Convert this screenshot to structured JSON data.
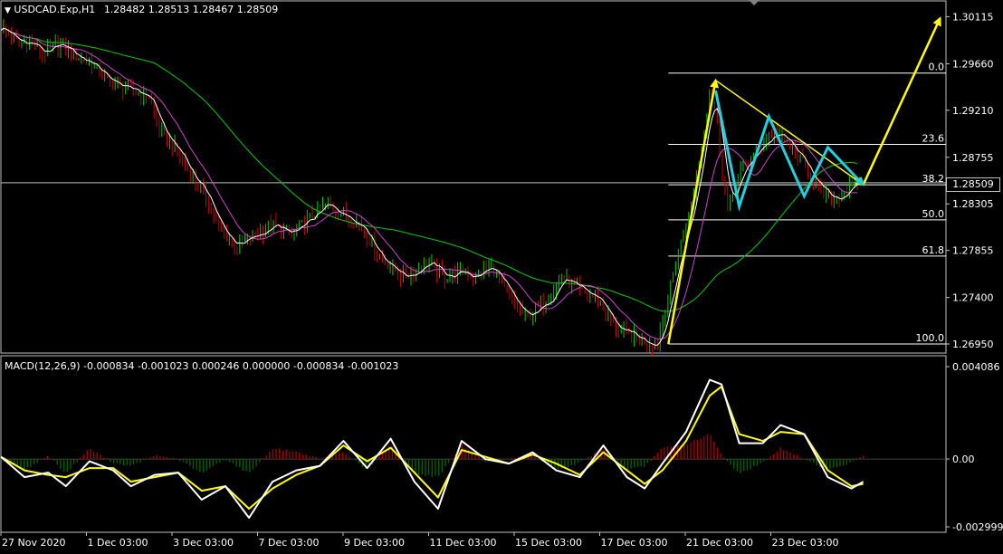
{
  "header": {
    "symbol": "USDCAD.Exp,H1",
    "ohlc": "1.28482 1.28513 1.28467 1.28509"
  },
  "macd": {
    "label": "MACD(12,26,9) -0.000834 -0.001023 0.000246 0.000000 -0.000834 -0.001023"
  },
  "current_price": "1.28509",
  "colors": {
    "background": "#000000",
    "frame": "#c0c0c0",
    "bull_candle": "#00c800",
    "bear_candle": "#c80000",
    "ma_green": "#00cc00",
    "ma_magenta": "#cc44cc",
    "ma_white": "#ffffff",
    "yellow": "#ffff00",
    "cyan": "#22d0e0",
    "fib": "#ffffff",
    "hist_pos": "#a00000",
    "hist_neg": "#006000"
  },
  "chart_data": [
    {
      "type": "candlestick",
      "series": "USDCAD.Exp,H1",
      "ylim": [
        1.2695,
        1.3011
      ],
      "yticks": [
        "1.30115",
        "1.29660",
        "1.29210",
        "1.28755",
        "1.28305",
        "1.27855",
        "1.27400",
        "1.26950"
      ],
      "xticks": [
        "27 Nov 2020",
        "1 Dec 03:00",
        "3 Dec 03:00",
        "7 Dec 03:00",
        "9 Dec 03:00",
        "11 Dec 03:00",
        "15 Dec 03:00",
        "17 Dec 03:00",
        "21 Dec 03:00",
        "23 Dec 03:00"
      ],
      "close_path": [
        [
          0,
          1.3002
        ],
        [
          0.3,
          1.2985
        ],
        [
          0.5,
          1.2988
        ],
        [
          0.7,
          1.2975
        ],
        [
          1.0,
          1.2985
        ],
        [
          1.3,
          1.2972
        ],
        [
          1.5,
          1.2968
        ],
        [
          1.8,
          1.295
        ],
        [
          2.0,
          1.2945
        ],
        [
          2.2,
          1.294
        ],
        [
          2.5,
          1.2935
        ],
        [
          2.7,
          1.29
        ],
        [
          3.0,
          1.288
        ],
        [
          3.2,
          1.286
        ],
        [
          3.5,
          1.2835
        ],
        [
          3.7,
          1.2805
        ],
        [
          4.0,
          1.279
        ],
        [
          4.3,
          1.28
        ],
        [
          4.6,
          1.281
        ],
        [
          4.9,
          1.28
        ],
        [
          5.2,
          1.2815
        ],
        [
          5.5,
          1.283
        ],
        [
          5.8,
          1.282
        ],
        [
          6.1,
          1.281
        ],
        [
          6.4,
          1.278
        ],
        [
          6.6,
          1.277
        ],
        [
          6.8,
          1.276
        ],
        [
          7.0,
          1.2765
        ],
        [
          7.2,
          1.2775
        ],
        [
          7.5,
          1.276
        ],
        [
          7.8,
          1.2765
        ],
        [
          8.0,
          1.276
        ],
        [
          8.3,
          1.277
        ],
        [
          8.6,
          1.274
        ],
        [
          8.9,
          1.272
        ],
        [
          9.2,
          1.2735
        ],
        [
          9.5,
          1.276
        ],
        [
          9.8,
          1.2745
        ],
        [
          10.1,
          1.274
        ],
        [
          10.4,
          1.271
        ],
        [
          10.6,
          1.2705
        ],
        [
          10.8,
          1.27
        ],
        [
          11.1,
          1.2695
        ],
        [
          11.3,
          1.274
        ],
        [
          11.5,
          1.279
        ],
        [
          11.7,
          1.283
        ],
        [
          11.9,
          1.29
        ],
        [
          12.0,
          1.294
        ],
        [
          12.1,
          1.292
        ],
        [
          12.2,
          1.287
        ],
        [
          12.3,
          1.2825
        ],
        [
          12.5,
          1.286
        ],
        [
          12.7,
          1.2875
        ],
        [
          12.9,
          1.289
        ],
        [
          13.1,
          1.29
        ],
        [
          13.3,
          1.289
        ],
        [
          13.5,
          1.2875
        ],
        [
          13.7,
          1.286
        ],
        [
          13.9,
          1.284
        ],
        [
          14.1,
          1.2835
        ],
        [
          14.3,
          1.2843
        ],
        [
          14.5,
          1.285
        ]
      ],
      "fibonacci": [
        {
          "level": "0.0",
          "price": 1.2957
        },
        {
          "level": "23.6",
          "price": 1.2888
        },
        {
          "level": "38.2",
          "price": 1.2849
        },
        {
          "level": "50.0",
          "price": 1.2815
        },
        {
          "level": "61.8",
          "price": 1.278
        },
        {
          "level": "100.0",
          "price": 1.2695
        }
      ],
      "annotations": [
        {
          "color": "yellow",
          "points": [
            [
              11.3,
              1.2695
            ],
            [
              12.1,
              1.295
            ]
          ],
          "arrow": true
        },
        {
          "color": "yellow",
          "points": [
            [
              12.1,
              1.295
            ],
            [
              14.6,
              1.2849
            ]
          ],
          "arrow": true
        },
        {
          "color": "yellow",
          "points": [
            [
              14.6,
              1.2849
            ],
            [
              15.9,
              1.301
            ]
          ],
          "arrow": true
        },
        {
          "color": "cyan",
          "points": [
            [
              12.1,
              1.294
            ],
            [
              12.5,
              1.2828
            ],
            [
              13.0,
              1.2915
            ],
            [
              13.6,
              1.2838
            ],
            [
              14.0,
              1.2885
            ],
            [
              14.6,
              1.2849
            ]
          ],
          "arrow": true
        }
      ]
    },
    {
      "type": "line",
      "series": "MACD(12,26,9)",
      "ylim": [
        -0.002999,
        0.004086
      ],
      "yticks": [
        "0.004086",
        "0.00",
        "-0.002999"
      ],
      "main": [
        [
          0,
          0.0001
        ],
        [
          0.4,
          -0.0008
        ],
        [
          0.8,
          -0.0006
        ],
        [
          1.1,
          -0.0012
        ],
        [
          1.5,
          -0.0001
        ],
        [
          1.9,
          -0.0005
        ],
        [
          2.2,
          -0.0012
        ],
        [
          2.6,
          -0.0007
        ],
        [
          3.0,
          -0.0006
        ],
        [
          3.4,
          -0.0018
        ],
        [
          3.8,
          -0.0012
        ],
        [
          4.2,
          -0.0026
        ],
        [
          4.6,
          -0.001
        ],
        [
          5.0,
          -0.0005
        ],
        [
          5.4,
          -0.0003
        ],
        [
          5.8,
          0.0008
        ],
        [
          6.2,
          -0.0004
        ],
        [
          6.6,
          0.0009
        ],
        [
          7.0,
          -0.001
        ],
        [
          7.4,
          -0.0022
        ],
        [
          7.8,
          0.0008
        ],
        [
          8.2,
          0.0
        ],
        [
          8.6,
          -0.0002
        ],
        [
          9.0,
          0.0003
        ],
        [
          9.4,
          -0.0005
        ],
        [
          9.8,
          -0.0008
        ],
        [
          10.2,
          0.0006
        ],
        [
          10.6,
          -0.0008
        ],
        [
          10.9,
          -0.0013
        ],
        [
          11.2,
          -0.0002
        ],
        [
          11.6,
          0.0012
        ],
        [
          12.0,
          0.0035
        ],
        [
          12.2,
          0.0033
        ],
        [
          12.5,
          0.0007
        ],
        [
          12.9,
          0.0007
        ],
        [
          13.2,
          0.0015
        ],
        [
          13.6,
          0.0011
        ],
        [
          14.0,
          -0.0008
        ],
        [
          14.4,
          -0.0013
        ],
        [
          14.6,
          -0.001
        ]
      ],
      "signal": [
        [
          0,
          0.0001
        ],
        [
          0.4,
          -0.0005
        ],
        [
          0.8,
          -0.0007
        ],
        [
          1.1,
          -0.0008
        ],
        [
          1.5,
          -0.0004
        ],
        [
          1.9,
          -0.0004
        ],
        [
          2.2,
          -0.001
        ],
        [
          2.6,
          -0.0008
        ],
        [
          3.0,
          -0.0006
        ],
        [
          3.4,
          -0.0014
        ],
        [
          3.8,
          -0.0012
        ],
        [
          4.2,
          -0.0022
        ],
        [
          4.6,
          -0.0013
        ],
        [
          5.0,
          -0.0007
        ],
        [
          5.4,
          -0.0003
        ],
        [
          5.8,
          0.0006
        ],
        [
          6.2,
          -0.0001
        ],
        [
          6.6,
          0.0005
        ],
        [
          7.0,
          -0.0006
        ],
        [
          7.4,
          -0.0017
        ],
        [
          7.8,
          0.0004
        ],
        [
          8.2,
          0.0001
        ],
        [
          8.6,
          -0.0002
        ],
        [
          9.0,
          0.0002
        ],
        [
          9.4,
          -0.0002
        ],
        [
          9.8,
          -0.0007
        ],
        [
          10.2,
          0.0003
        ],
        [
          10.6,
          -0.0005
        ],
        [
          10.9,
          -0.0011
        ],
        [
          11.2,
          -0.0005
        ],
        [
          11.6,
          0.0008
        ],
        [
          12.0,
          0.0028
        ],
        [
          12.2,
          0.0032
        ],
        [
          12.5,
          0.0011
        ],
        [
          12.9,
          0.0008
        ],
        [
          13.2,
          0.0012
        ],
        [
          13.6,
          0.0011
        ],
        [
          14.0,
          -0.0005
        ],
        [
          14.4,
          -0.0012
        ],
        [
          14.6,
          -0.0011
        ]
      ]
    }
  ]
}
